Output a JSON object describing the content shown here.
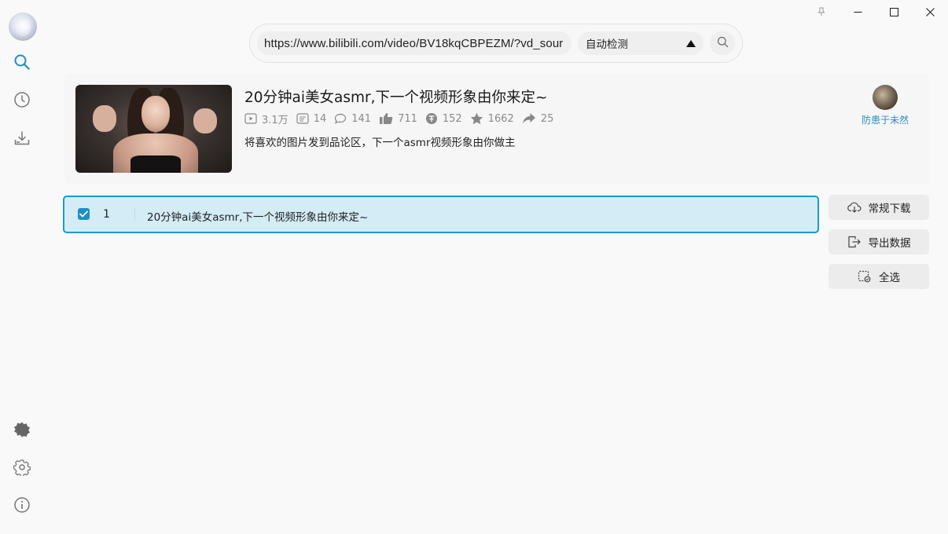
{
  "window": {
    "controls": [
      "pin-icon",
      "minimize-icon",
      "maximize-icon",
      "close-icon"
    ]
  },
  "sidebar": {
    "top_items": [
      {
        "name": "search",
        "icon": "search-icon",
        "active": true
      },
      {
        "name": "history",
        "icon": "clock-icon",
        "active": false
      },
      {
        "name": "downloads",
        "icon": "download-tray-icon",
        "active": false
      }
    ],
    "bottom_items": [
      {
        "name": "theme",
        "icon": "theme-toggle-icon"
      },
      {
        "name": "settings",
        "icon": "gear-icon"
      },
      {
        "name": "about",
        "icon": "info-icon"
      }
    ],
    "accent_color": "#1c8fc4"
  },
  "search": {
    "url_value": "https://www.bilibili.com/video/BV18kqCBPEZM/?vd_sour",
    "mode_label": "自动检测"
  },
  "video": {
    "title": "20分钟ai美女asmr,下一个视频形象由你来定~",
    "stats": {
      "views": "3.1万",
      "danmaku": "14",
      "comments": "141",
      "likes": "711",
      "coins": "152",
      "favorites": "1662",
      "shares": "25"
    },
    "description": "将喜欢的图片发到品论区，下一个asmr视频形象由你做主",
    "uploader": "防患于未然"
  },
  "list": {
    "rows": [
      {
        "index": "1",
        "title": "20分钟ai美女asmr,下一个视频形象由你来定~",
        "checked": true
      }
    ]
  },
  "actions": {
    "download_label": "常规下载",
    "export_label": "导出数据",
    "select_all_label": "全选"
  }
}
